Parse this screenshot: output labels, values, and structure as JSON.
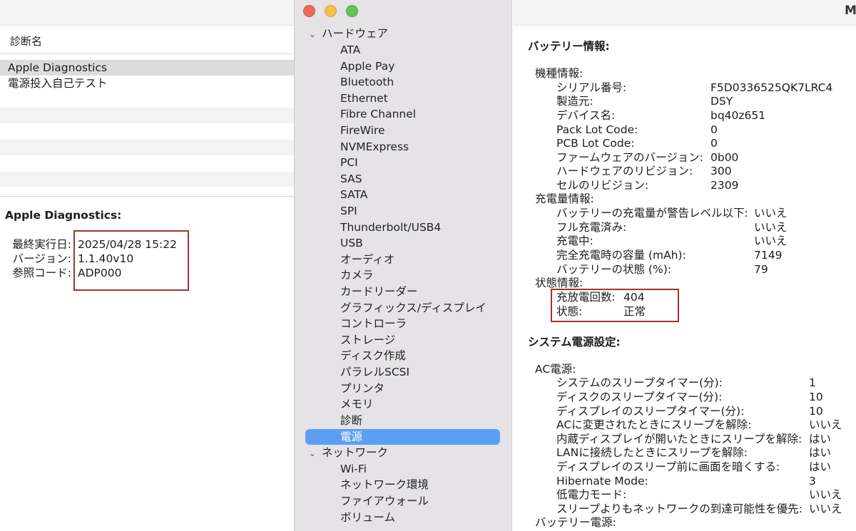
{
  "left": {
    "column_header": "診断名",
    "rows": [
      "Apple Diagnostics",
      "電源投入自己テスト"
    ],
    "detail_title": "Apple Diagnostics:",
    "details": [
      {
        "label": "最終実行日:",
        "value": "2025/04/28 15:22"
      },
      {
        "label": "バージョン:",
        "value": "1.1.40v10"
      },
      {
        "label": "参照コード:",
        "value": "ADP000"
      }
    ]
  },
  "sidebar": {
    "hardware_section": "ハードウェア",
    "hardware_items": [
      "ATA",
      "Apple Pay",
      "Bluetooth",
      "Ethernet",
      "Fibre Channel",
      "FireWire",
      "NVMExpress",
      "PCI",
      "SAS",
      "SATA",
      "SPI",
      "Thunderbolt/USB4",
      "USB",
      "オーディオ",
      "カメラ",
      "カードリーダー",
      "グラフィックス/ディスプレイ",
      "コントローラ",
      "ストレージ",
      "ディスク作成",
      "パラレルSCSI",
      "プリンタ",
      "メモリ",
      "診断",
      "電源"
    ],
    "selected_item": "電源",
    "network_section": "ネットワーク",
    "network_items": [
      "Wi-Fi",
      "ネットワーク環境",
      "ファイアウォール",
      "ボリューム"
    ]
  },
  "right": {
    "window_title_fragment": "M",
    "battery_title": "バッテリー情報:",
    "model_info": {
      "title": "機種情報:",
      "rows": [
        {
          "label": "シリアル番号:",
          "value": "F5D0336525QK7LRC4"
        },
        {
          "label": "製造元:",
          "value": "DSY"
        },
        {
          "label": "デバイス名:",
          "value": "bq40z651"
        },
        {
          "label": "Pack Lot Code:",
          "value": "0"
        },
        {
          "label": "PCB Lot Code:",
          "value": "0"
        },
        {
          "label": "ファームウェアのバージョン:",
          "value": "0b00"
        },
        {
          "label": "ハードウェアのリビジョン:",
          "value": "300"
        },
        {
          "label": "セルのリビジョン:",
          "value": "2309"
        }
      ]
    },
    "charge_info": {
      "title": "充電量情報:",
      "rows": [
        {
          "label": "バッテリーの充電量が警告レベル以下:",
          "value": "いいえ"
        },
        {
          "label": "フル充電済み:",
          "value": "いいえ"
        },
        {
          "label": "充電中:",
          "value": "いいえ"
        },
        {
          "label": "完全充電時の容量 (mAh):",
          "value": "7149"
        },
        {
          "label": "バッテリーの状態 (%):",
          "value": "79"
        }
      ]
    },
    "health_info": {
      "title": "状態情報:",
      "rows": [
        {
          "label": "充放電回数:",
          "value": "404"
        },
        {
          "label": "状態:",
          "value": "正常"
        }
      ]
    },
    "power_title": "システム電源設定:",
    "ac_power": {
      "title": "AC電源:",
      "rows": [
        {
          "label": "システムのスリープタイマー(分):",
          "value": "1"
        },
        {
          "label": "ディスクのスリープタイマー(分):",
          "value": "10"
        },
        {
          "label": "ディスプレイのスリープタイマー(分):",
          "value": "10"
        },
        {
          "label": "ACに変更されたときにスリープを解除:",
          "value": "いいえ"
        },
        {
          "label": "内蔵ディスプレイが開いたときにスリープを解除:",
          "value": "はい"
        },
        {
          "label": "LANに接続したときにスリープを解除:",
          "value": "はい"
        },
        {
          "label": "ディスプレイのスリープ前に画面を暗くする:",
          "value": "はい"
        },
        {
          "label": "Hibernate Mode:",
          "value": "3"
        },
        {
          "label": "低電力モード:",
          "value": "いいえ"
        },
        {
          "label": "スリープよりもネットワークの到達可能性を優先:",
          "value": "いいえ"
        }
      ]
    },
    "battery_power_title": "バッテリー電源:"
  },
  "colors": {
    "highlight_box": "#a3342a",
    "sidebar_selection": "#5d9ef5",
    "sidebar_bg": "#e5e3e6"
  }
}
